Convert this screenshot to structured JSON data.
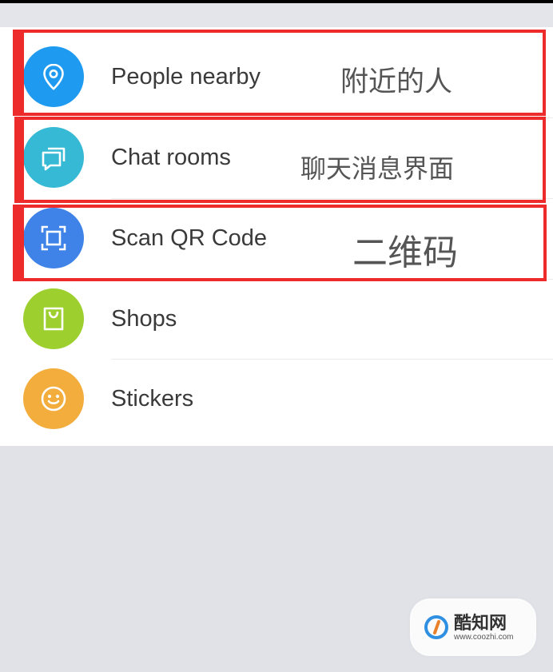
{
  "menu": {
    "items": [
      {
        "label": "People nearby",
        "icon": "location-pin-icon",
        "color": "#1e9af0"
      },
      {
        "label": "Chat rooms",
        "icon": "chat-bubbles-icon",
        "color": "#35b9d4"
      },
      {
        "label": "Scan QR Code",
        "icon": "scan-icon",
        "color": "#3f82e8"
      },
      {
        "label": "Shops",
        "icon": "shopping-bag-icon",
        "color": "#9dd02e"
      },
      {
        "label": "Stickers",
        "icon": "smiley-icon",
        "color": "#f2ad3d"
      }
    ]
  },
  "annotations": {
    "people_nearby": "附近的人",
    "chat_rooms": "聊天消息界面",
    "scan_qr": "二维码",
    "highlight_color": "#ee2b2b"
  },
  "watermark": {
    "name": "酷知网",
    "url": "www.coozhi.com"
  }
}
